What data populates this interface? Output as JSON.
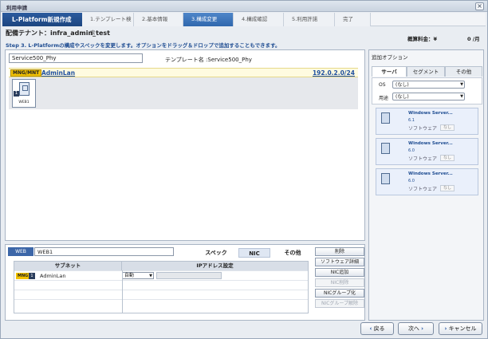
{
  "window": {
    "title": "利用申請",
    "close_label": "×"
  },
  "wizard": {
    "title": "L-Platform新規作成",
    "steps": [
      {
        "label": "1.テンプレート検索",
        "active": false
      },
      {
        "label": "2.基本情報",
        "active": false
      },
      {
        "label": "3.構成変更",
        "active": true
      },
      {
        "label": "4.構成確認",
        "active": false
      },
      {
        "label": "5.利用許諾",
        "active": false
      },
      {
        "label": "完了",
        "active": false
      }
    ]
  },
  "tenant": "配備テナント：infra_admin_test",
  "fee": {
    "label": "概算料金：¥",
    "value": "0 /月"
  },
  "step_description": "Step 3. L-Platformの構成やスペックを変更します。オプションをドラッグ＆ドロップで追加することもできます。",
  "main": {
    "name_value": "Service500_Phy",
    "template_label": "テンプレート名 :Service500_Phy",
    "lan": {
      "tag": "MNG/MNT",
      "name": "AdminLan",
      "subnet": "192.0.2.0/24"
    },
    "node": {
      "number": "1",
      "label": "WEB1"
    }
  },
  "options": {
    "title": "追加オプション",
    "tabs": [
      {
        "label": "サーバ",
        "active": true
      },
      {
        "label": "セグメント",
        "active": false
      },
      {
        "label": "その他",
        "active": false
      }
    ],
    "filters": [
      {
        "label": "OS",
        "value": "(なし)"
      },
      {
        "label": "用途",
        "value": "(なし)"
      }
    ],
    "cards": [
      {
        "name": "Windows Server...",
        "version": "6.1",
        "type": "ソフトウェア",
        "badge": "なし"
      },
      {
        "name": "Windows Server...",
        "version": "6.0",
        "type": "ソフトウェア",
        "badge": "なし"
      },
      {
        "name": "Windows Server...",
        "version": "6.0",
        "type": "ソフトウェア",
        "badge": "なし"
      }
    ]
  },
  "detail": {
    "tag": "WEB",
    "server_name": "WEB1",
    "tabs": [
      {
        "label": "スペック",
        "active": false
      },
      {
        "label": "NIC",
        "active": true
      },
      {
        "label": "その他",
        "active": false
      }
    ],
    "table": {
      "headers": [
        "サブネット",
        "IPアドレス設定"
      ],
      "rows": [
        {
          "mng": "MNG",
          "num": "1",
          "subnet": "AdminLan",
          "ip_mode": "自動"
        }
      ]
    },
    "actions": [
      {
        "label": "削除",
        "enabled": true
      },
      {
        "label": "ソフトウェア詳細",
        "enabled": true
      },
      {
        "label": "NIC追加",
        "enabled": true
      },
      {
        "label": "NIC削除",
        "enabled": false
      },
      {
        "label": "NICグループ化",
        "enabled": true
      },
      {
        "label": "NICグループ解除",
        "enabled": false
      }
    ]
  },
  "nav": {
    "back": "戻る",
    "next": "次へ",
    "cancel": "キャンセル",
    "back_chev": "‹",
    "next_chev": "›",
    "cancel_chev": "›"
  }
}
